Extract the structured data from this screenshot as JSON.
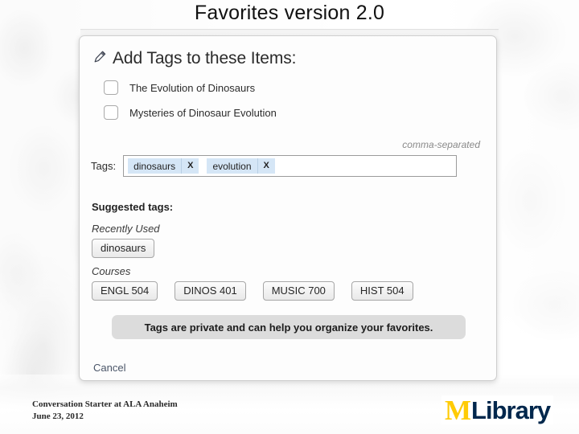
{
  "slide": {
    "title": "Favorites version 2.0"
  },
  "dialog": {
    "heading": "Add Tags to these Items:",
    "heading_icon": "tag-icon",
    "items": [
      {
        "label": "The Evolution of Dinosaurs",
        "checked": false
      },
      {
        "label": "Mysteries of Dinosaur Evolution",
        "checked": false
      }
    ],
    "tags_field": {
      "label": "Tags:",
      "hint": "comma-separated",
      "chips": [
        {
          "text": "dinosaurs",
          "remove": "X"
        },
        {
          "text": "evolution",
          "remove": "X"
        }
      ]
    },
    "suggested": {
      "title": "Suggested tags:",
      "groups": [
        {
          "label": "Recently Used",
          "tags": [
            "dinosaurs"
          ]
        },
        {
          "label": "Courses",
          "tags": [
            "ENGL 504",
            "DINOS 401",
            "MUSIC 700",
            "HIST 504"
          ]
        }
      ]
    },
    "notice": "Tags are private and can help you organize your favorites.",
    "cancel_label": "Cancel"
  },
  "footer": {
    "line1": "Conversation Starter at ALA Anaheim",
    "line2": "June 23, 2012",
    "logo": {
      "mark": "M",
      "word": "Library",
      "mark_color": "#FFCB05",
      "word_color": "#00274C"
    }
  }
}
